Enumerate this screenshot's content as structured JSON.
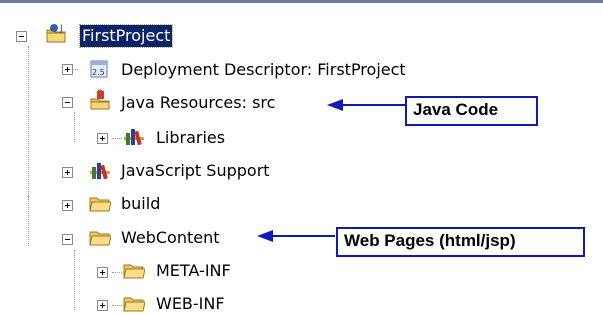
{
  "tree": {
    "root": {
      "label": "FirstProject",
      "expanded": true,
      "selected": true
    },
    "items": [
      {
        "label": "Deployment Descriptor: FirstProject",
        "expanded": false,
        "icon": "deployment-descriptor-icon"
      },
      {
        "label": "Java Resources: src",
        "expanded": true,
        "icon": "java-resources-icon"
      },
      {
        "label": "Libraries",
        "expanded": false,
        "icon": "libraries-icon"
      },
      {
        "label": "JavaScript Support",
        "expanded": false,
        "icon": "libraries-icon"
      },
      {
        "label": "build",
        "expanded": false,
        "icon": "folder-icon"
      },
      {
        "label": "WebContent",
        "expanded": true,
        "icon": "folder-icon"
      },
      {
        "label": "META-INF",
        "expanded": false,
        "icon": "folder-icon"
      },
      {
        "label": "WEB-INF",
        "expanded": false,
        "icon": "folder-icon"
      }
    ],
    "root_icon": "project-icon"
  },
  "callouts": {
    "java_code": "Java Code",
    "web_pages": "Web Pages (html/jsp)"
  },
  "colors": {
    "selection": "#0a246a",
    "callout_border": "#1018b8",
    "arrow": "#1018b8"
  }
}
